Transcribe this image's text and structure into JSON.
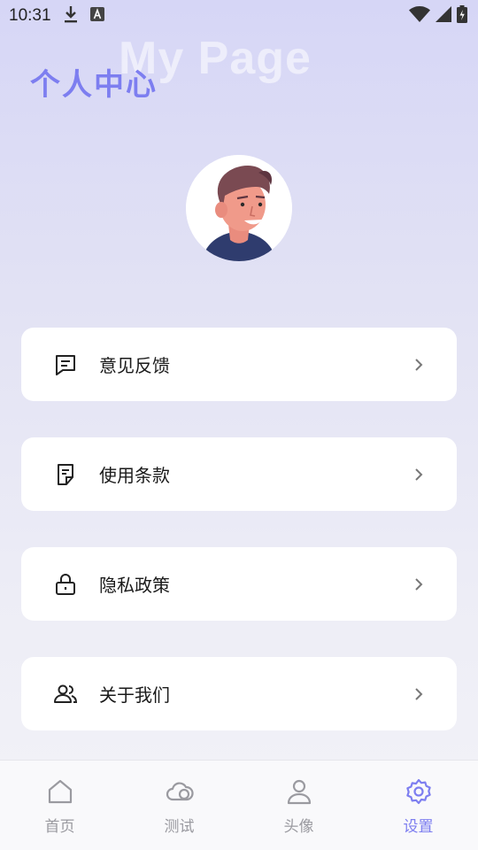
{
  "status_bar": {
    "time": "10:31"
  },
  "header": {
    "bg_text": "My Page",
    "title": "个人中心"
  },
  "menu": [
    {
      "label": "意见反馈",
      "icon": "feedback-message-icon"
    },
    {
      "label": "使用条款",
      "icon": "terms-document-icon"
    },
    {
      "label": "隐私政策",
      "icon": "privacy-lock-icon"
    },
    {
      "label": "关于我们",
      "icon": "about-users-icon"
    }
  ],
  "tabs": [
    {
      "label": "首页",
      "icon": "home-icon",
      "active": false
    },
    {
      "label": "测试",
      "icon": "test-cloud-icon",
      "active": false
    },
    {
      "label": "头像",
      "icon": "avatar-person-icon",
      "active": false
    },
    {
      "label": "设置",
      "icon": "settings-gear-icon",
      "active": true
    }
  ],
  "colors": {
    "accent": "#7d7ef0",
    "inactive": "#9a9aa0"
  }
}
